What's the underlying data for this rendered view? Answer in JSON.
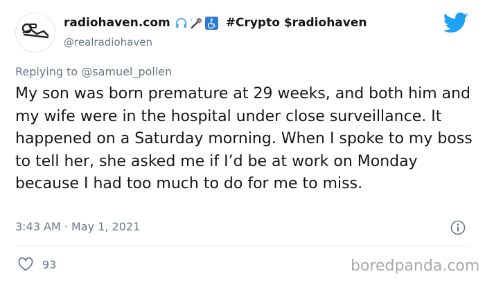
{
  "tweet": {
    "author": {
      "display_name": "radiohaven.com",
      "name_tags": "#Crypto $radiohaven",
      "handle": "@realradiohaven",
      "emoji": [
        "headphones",
        "microphone",
        "wheelchair"
      ]
    },
    "reply_to": "Replying to @samuel_pollen",
    "text": "My son was born premature at 29 weeks, and both him and my wife were in the hospital under close surveillance. It happened on a Saturday morning. When I spoke to my boss to tell her, she asked me if I’d be at work on Monday because I had too much to do for me to miss.",
    "timestamp": "3:43 AM · May 1, 2021",
    "likes": "93"
  },
  "watermark": "boredpanda.com",
  "colors": {
    "twitter_blue": "#1da1f2",
    "secondary_text": "#657786",
    "primary_text": "#14171a",
    "divider": "#e1e8ed",
    "watermark": "#a9a9a9"
  },
  "icons": [
    "avatar",
    "headphones-icon",
    "microphone-icon",
    "wheelchair-icon",
    "twitter-logo-icon",
    "info-icon",
    "heart-icon"
  ]
}
